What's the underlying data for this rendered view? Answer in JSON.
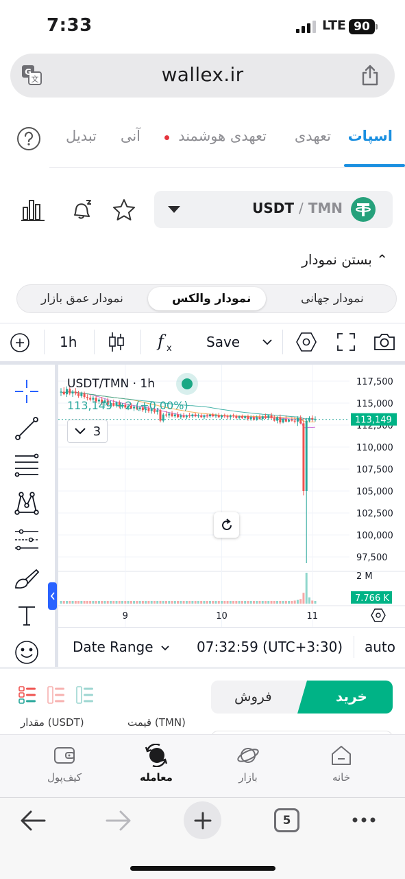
{
  "status_bar": {
    "time": "7:33",
    "network": "LTE",
    "battery": "90"
  },
  "browser": {
    "url": "wallex.ir",
    "open_tabs": "5"
  },
  "tabs": [
    {
      "label": "اسپات",
      "active": true
    },
    {
      "label": "تعهدی"
    },
    {
      "label": "تعهدی هوشمند"
    },
    {
      "label": "آنی"
    },
    {
      "label": "تبدیل"
    }
  ],
  "market": {
    "base": "USDT",
    "separator": "/",
    "quote": "TMN"
  },
  "close_chart_label": "بستن نمودار",
  "chart_tabs": [
    {
      "label": "نمودار جهانی"
    },
    {
      "label": "نمودار والکس",
      "active": true
    },
    {
      "label": "نمودار عمق بازار"
    }
  ],
  "chart_toolbar": {
    "interval": "1h",
    "save": "Save"
  },
  "chart_legend": {
    "symbol": "USDT/TMN · 1h",
    "value": "113,149  +2 (+0.00%)",
    "indicators_count": "3"
  },
  "chart_data": {
    "type": "candlestick",
    "x_labels": [
      "9",
      "10",
      "11"
    ],
    "y_ticks": [
      "117,500",
      "115,000",
      "112,500",
      "110,000",
      "107,500",
      "105,000",
      "102,500",
      "100,000",
      "97,500"
    ],
    "last_price": "113,149",
    "volume_max_label": "2 M",
    "volume_last": "7.766 K",
    "candles": [
      [
        116200,
        116700,
        115800,
        116300
      ],
      [
        116300,
        116800,
        115900,
        116000
      ],
      [
        116000,
        116900,
        115700,
        116600
      ],
      [
        116600,
        116800,
        115900,
        116100
      ],
      [
        116100,
        116500,
        115700,
        116300
      ],
      [
        116300,
        116700,
        115900,
        116100
      ],
      [
        116100,
        116400,
        115600,
        115800
      ],
      [
        115800,
        116300,
        115600,
        116100
      ],
      [
        116100,
        116300,
        115500,
        115700
      ],
      [
        115700,
        116000,
        115300,
        115600
      ],
      [
        115600,
        115900,
        115200,
        115400
      ],
      [
        115400,
        115800,
        115100,
        115600
      ],
      [
        115600,
        115800,
        115000,
        115200
      ],
      [
        115200,
        115600,
        114900,
        115400
      ],
      [
        115400,
        115700,
        114800,
        115000
      ],
      [
        115000,
        115500,
        114700,
        115300
      ],
      [
        115300,
        115600,
        114600,
        114800
      ],
      [
        114800,
        115300,
        114500,
        115000
      ],
      [
        115000,
        115400,
        114600,
        114700
      ],
      [
        114700,
        115200,
        114500,
        115100
      ],
      [
        115100,
        115300,
        114400,
        114600
      ],
      [
        114600,
        115000,
        114400,
        114800
      ],
      [
        114800,
        115100,
        114300,
        114500
      ],
      [
        114500,
        114900,
        114200,
        114700
      ],
      [
        114700,
        115000,
        114300,
        114400
      ],
      [
        114400,
        114800,
        114100,
        114600
      ],
      [
        114600,
        114900,
        114200,
        114300
      ],
      [
        114300,
        114700,
        114100,
        114500
      ],
      [
        114500,
        114800,
        114000,
        114200
      ],
      [
        114200,
        114600,
        113900,
        114400
      ],
      [
        114400,
        114700,
        113900,
        114100
      ],
      [
        114100,
        114500,
        113800,
        114300
      ],
      [
        114300,
        114500,
        113800,
        114000
      ],
      [
        114000,
        114400,
        113700,
        114200
      ],
      [
        114200,
        114400,
        112800,
        113000
      ],
      [
        113000,
        113900,
        112800,
        113700
      ],
      [
        113700,
        114100,
        113400,
        113600
      ],
      [
        113600,
        114000,
        113300,
        113800
      ],
      [
        113800,
        114100,
        113400,
        113500
      ],
      [
        113500,
        113900,
        113300,
        113700
      ],
      [
        113700,
        114000,
        113300,
        113400
      ],
      [
        113400,
        113800,
        113200,
        113600
      ],
      [
        113600,
        113900,
        113300,
        113400
      ],
      [
        113400,
        113700,
        113200,
        113600
      ],
      [
        113600,
        113900,
        113300,
        113500
      ],
      [
        113500,
        113800,
        113300,
        113700
      ],
      [
        113700,
        113900,
        113400,
        113500
      ],
      [
        113500,
        113800,
        113300,
        113600
      ],
      [
        113600,
        113800,
        113300,
        113400
      ],
      [
        113400,
        113700,
        113200,
        113600
      ],
      [
        113600,
        113800,
        113300,
        113500
      ],
      [
        113500,
        113800,
        113300,
        113700
      ],
      [
        113700,
        113900,
        113400,
        113500
      ],
      [
        113500,
        113800,
        113300,
        113600
      ],
      [
        113600,
        113900,
        113300,
        113400
      ],
      [
        113400,
        113700,
        113200,
        113600
      ],
      [
        113600,
        113800,
        113300,
        113500
      ],
      [
        113500,
        113700,
        113200,
        113400
      ],
      [
        113400,
        113700,
        113200,
        113600
      ],
      [
        113600,
        113800,
        113300,
        113500
      ],
      [
        113500,
        113700,
        113200,
        113300
      ],
      [
        113300,
        113600,
        113100,
        113500
      ],
      [
        113500,
        113700,
        113200,
        113300
      ],
      [
        113300,
        113600,
        113100,
        113500
      ],
      [
        113500,
        113700,
        113000,
        113200
      ],
      [
        113200,
        113600,
        113000,
        113400
      ],
      [
        113400,
        113600,
        113000,
        113100
      ],
      [
        113100,
        113600,
        113000,
        113400
      ],
      [
        113400,
        113700,
        113100,
        113200
      ],
      [
        113200,
        113600,
        113000,
        113500
      ],
      [
        113500,
        113800,
        113200,
        113300
      ],
      [
        113300,
        113700,
        113100,
        113600
      ],
      [
        113600,
        113900,
        113200,
        113300
      ],
      [
        113300,
        113600,
        112900,
        113000
      ],
      [
        113000,
        113500,
        112700,
        113400
      ],
      [
        113400,
        113700,
        112600,
        112800
      ],
      [
        112800,
        113300,
        112700,
        113200
      ],
      [
        113200,
        113600,
        112800,
        112900
      ],
      [
        112900,
        113200,
        112800,
        113100
      ],
      [
        113100,
        113400,
        112900,
        113000
      ],
      [
        113000,
        113400,
        112700,
        112900
      ],
      [
        112900,
        113500,
        112400,
        113300
      ],
      [
        113300,
        113600,
        112600,
        112700
      ],
      [
        112700,
        113300,
        104500,
        105000
      ],
      [
        105000,
        113300,
        96800,
        113000
      ],
      [
        113000,
        113500,
        112800,
        113300
      ],
      [
        113300,
        113600,
        112900,
        113100
      ],
      [
        113100,
        113500,
        112900,
        113149
      ]
    ],
    "volumes": [
      0.08,
      0.06,
      0.07,
      0.05,
      0.06,
      0.07,
      0.05,
      0.06,
      0.05,
      0.07,
      0.06,
      0.05,
      0.06,
      0.05,
      0.07,
      0.05,
      0.06,
      0.05,
      0.06,
      0.07,
      0.05,
      0.06,
      0.05,
      0.07,
      0.06,
      0.05,
      0.06,
      0.05,
      0.06,
      0.05,
      0.07,
      0.06,
      0.05,
      0.06,
      0.09,
      0.06,
      0.05,
      0.06,
      0.05,
      0.06,
      0.07,
      0.05,
      0.06,
      0.05,
      0.06,
      0.05,
      0.06,
      0.07,
      0.05,
      0.06,
      0.05,
      0.06,
      0.05,
      0.06,
      0.05,
      0.07,
      0.06,
      0.05,
      0.06,
      0.05,
      0.06,
      0.07,
      0.05,
      0.06,
      0.05,
      0.06,
      0.05,
      0.07,
      0.06,
      0.05,
      0.06,
      0.08,
      0.07,
      0.06,
      0.08,
      0.07,
      0.06,
      0.09,
      0.08,
      0.07,
      0.1,
      0.12,
      0.15,
      0.35,
      1.0,
      0.2,
      0.1,
      0.06
    ]
  },
  "chart_footer": {
    "date_range": "Date Range",
    "time": "07:32:59 (UTC+3:30)",
    "scale": "auto"
  },
  "order": {
    "buy": "خرید",
    "sell": "فروش",
    "price_label": "قیمت (TMN)",
    "amount_label": "مقدار (USDT)"
  },
  "app_nav": [
    {
      "label": "خانه"
    },
    {
      "label": "بازار"
    },
    {
      "label": "معامله",
      "active": true
    },
    {
      "label": "کیف‌پول"
    }
  ],
  "colors": {
    "accent_blue": "#1a8fe0",
    "green": "#00b386",
    "candle_up": "#26a69a",
    "candle_down": "#ef5350",
    "smart_dot": "#e5343d"
  }
}
